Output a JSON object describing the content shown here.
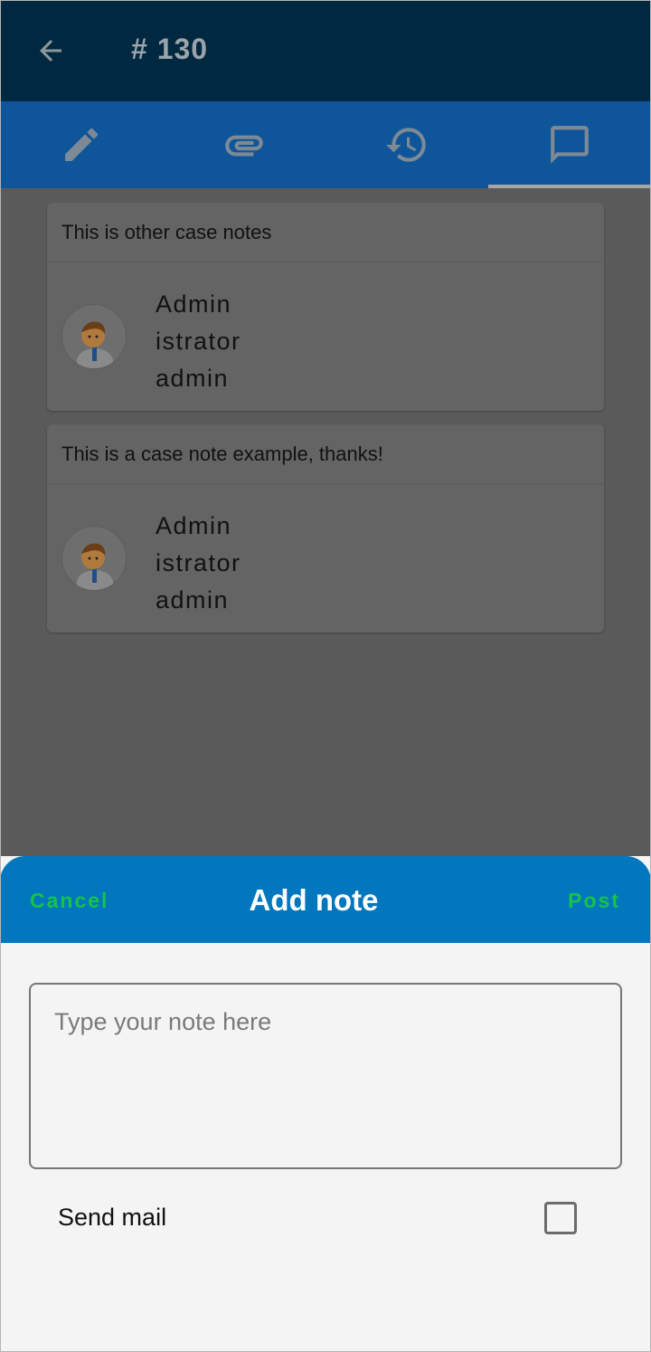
{
  "app_bar": {
    "title": "# 130",
    "back_icon": "arrow-left-icon"
  },
  "tabs": [
    {
      "icon": "pencil-icon",
      "active": false
    },
    {
      "icon": "paperclip-icon",
      "active": false
    },
    {
      "icon": "history-icon",
      "active": false
    },
    {
      "icon": "comment-icon",
      "active": true
    }
  ],
  "notes": [
    {
      "text": "This is other case notes",
      "author_lines": [
        "Admin",
        "istrator",
        "admin"
      ]
    },
    {
      "text": "This is a case note example, thanks!",
      "author_lines": [
        "Admin",
        "istrator",
        "admin"
      ]
    }
  ],
  "sheet": {
    "cancel_label": "Cancel",
    "title": "Add note",
    "post_label": "Post",
    "note_placeholder": "Type your note here",
    "note_value": "",
    "send_mail_label": "Send mail",
    "send_mail_checked": false
  },
  "colors": {
    "app_bar": "#002840",
    "tab_bar": "#0e5599",
    "sheet_header": "#0277bd",
    "action_green": "#17c24b",
    "scrim_bg": "#5a5a5a"
  }
}
